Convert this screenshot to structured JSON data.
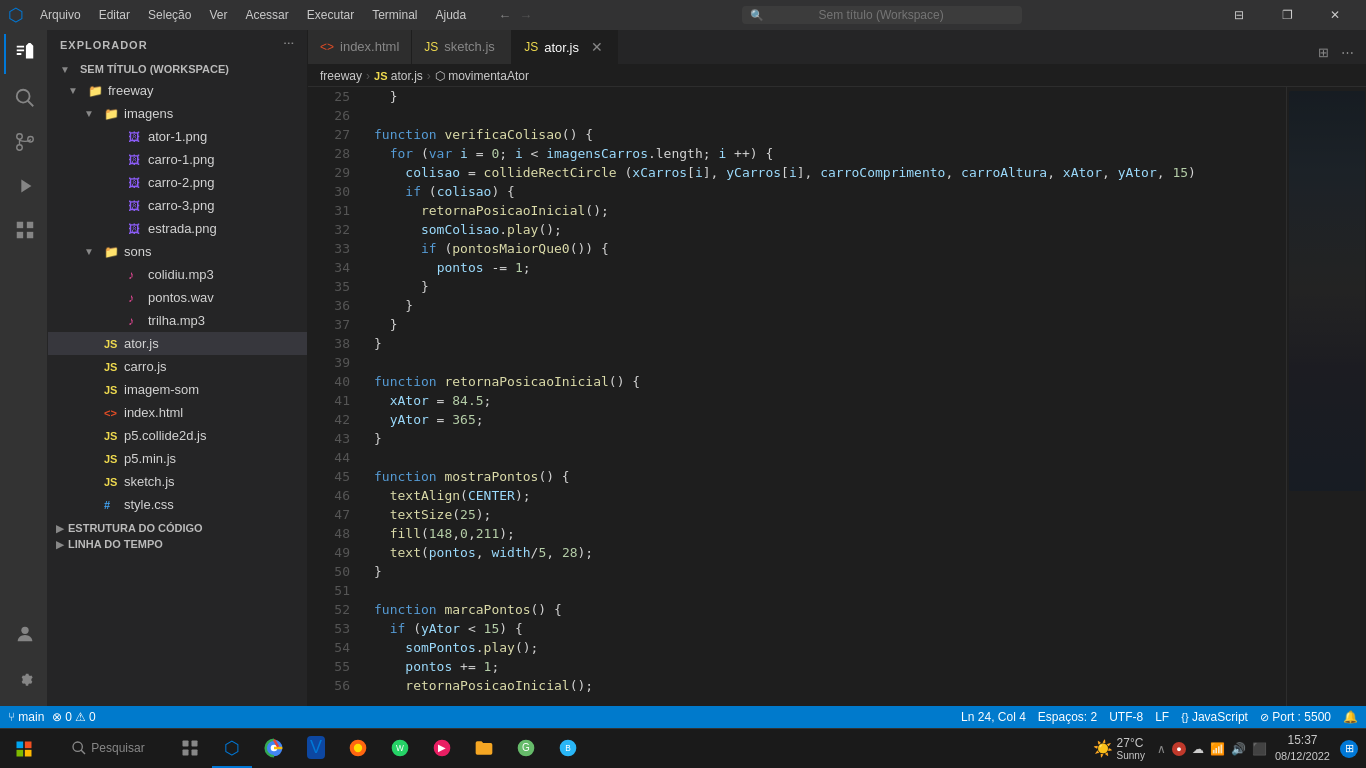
{
  "titlebar": {
    "icon": "⬡",
    "menu": [
      "Arquivo",
      "Editar",
      "Seleção",
      "Ver",
      "Acessar",
      "Executar",
      "Terminal",
      "Ajuda"
    ],
    "search_placeholder": "Sem título (Workspace)",
    "nav_back": "←",
    "nav_fwd": "→",
    "controls": [
      "⊟",
      "❐",
      "✕"
    ]
  },
  "tabs": [
    {
      "id": "index-html",
      "icon": "html",
      "label": "index.html",
      "active": false,
      "closable": false
    },
    {
      "id": "sketch-js",
      "icon": "js",
      "label": "sketch.js",
      "active": false,
      "closable": false
    },
    {
      "id": "ator-js",
      "icon": "js",
      "label": "ator.js",
      "active": true,
      "closable": true
    }
  ],
  "breadcrumb": [
    "freeway",
    "JS ator.js",
    "⬡ movimentaAtor"
  ],
  "explorer": {
    "title": "EXPLORADOR",
    "workspace_label": "SEM TÍTULO (WORKSPACE)",
    "tree": [
      {
        "type": "folder",
        "label": "freeway",
        "indent": 0,
        "open": true
      },
      {
        "type": "folder",
        "label": "imagens",
        "indent": 1,
        "open": true
      },
      {
        "type": "file",
        "label": "ator-1.png",
        "indent": 2,
        "filetype": "png"
      },
      {
        "type": "file",
        "label": "carro-1.png",
        "indent": 2,
        "filetype": "png"
      },
      {
        "type": "file",
        "label": "carro-2.png",
        "indent": 2,
        "filetype": "png"
      },
      {
        "type": "file",
        "label": "carro-3.png",
        "indent": 2,
        "filetype": "png"
      },
      {
        "type": "file",
        "label": "estrada.png",
        "indent": 2,
        "filetype": "png"
      },
      {
        "type": "folder",
        "label": "sons",
        "indent": 1,
        "open": true
      },
      {
        "type": "file",
        "label": "colidiu.mp3",
        "indent": 2,
        "filetype": "audio"
      },
      {
        "type": "file",
        "label": "pontos.wav",
        "indent": 2,
        "filetype": "audio"
      },
      {
        "type": "file",
        "label": "trilha.mp3",
        "indent": 2,
        "filetype": "audio"
      },
      {
        "type": "file",
        "label": "ator.js",
        "indent": 1,
        "filetype": "js",
        "selected": true
      },
      {
        "type": "file",
        "label": "carro.js",
        "indent": 1,
        "filetype": "js"
      },
      {
        "type": "file",
        "label": "imagem-som",
        "indent": 1,
        "filetype": "js"
      },
      {
        "type": "file",
        "label": "index.html",
        "indent": 1,
        "filetype": "html"
      },
      {
        "type": "file",
        "label": "p5.collide2d.js",
        "indent": 1,
        "filetype": "js"
      },
      {
        "type": "file",
        "label": "p5.min.js",
        "indent": 1,
        "filetype": "js"
      },
      {
        "type": "file",
        "label": "sketch.js",
        "indent": 1,
        "filetype": "js"
      },
      {
        "type": "file",
        "label": "style.css",
        "indent": 1,
        "filetype": "css"
      }
    ],
    "sections": [
      {
        "label": "ESTRUTURA DO CÓDIGO"
      },
      {
        "label": "LINHA DO TEMPO"
      }
    ]
  },
  "sidebar_icons": [
    {
      "id": "explorer",
      "symbol": "⧉",
      "active": true
    },
    {
      "id": "search",
      "symbol": "🔍",
      "active": false
    },
    {
      "id": "git",
      "symbol": "⑂",
      "active": false
    },
    {
      "id": "debug",
      "symbol": "▷",
      "active": false
    },
    {
      "id": "extensions",
      "symbol": "⊞",
      "active": false
    }
  ],
  "code_lines": [
    {
      "num": 25,
      "content": "  }"
    },
    {
      "num": 26,
      "content": ""
    },
    {
      "num": 27,
      "content": "function verificaColisao() {",
      "tokens": [
        {
          "t": "kw",
          "v": "function"
        },
        {
          "t": "punct",
          "v": " "
        },
        {
          "t": "fn",
          "v": "verificaColisao"
        },
        {
          "t": "punct",
          "v": "() {"
        }
      ]
    },
    {
      "num": 28,
      "content": "  for (var i = 0; i < imagensCarros.length; i ++) {",
      "tokens": [
        {
          "t": "kw",
          "v": "  for"
        },
        {
          "t": "punct",
          "v": " ("
        },
        {
          "t": "kw",
          "v": "var"
        },
        {
          "t": "punct",
          "v": " "
        },
        {
          "t": "var",
          "v": "i"
        },
        {
          "t": "punct",
          "v": " = "
        },
        {
          "t": "num",
          "v": "0"
        },
        {
          "t": "punct",
          "v": "; "
        },
        {
          "t": "var",
          "v": "i"
        },
        {
          "t": "punct",
          "v": " < "
        },
        {
          "t": "var",
          "v": "imagensCarros"
        },
        {
          "t": "punct",
          "v": ".length; "
        },
        {
          "t": "var",
          "v": "i"
        },
        {
          "t": "punct",
          "v": " ++) {"
        }
      ]
    },
    {
      "num": 29,
      "content": "    colisao = collideRectCircle (xCarros[i], yCarros[i], carroComprimento, carroAltura, xAtor, yAtor, 15)",
      "tokens": [
        {
          "t": "punct",
          "v": "    "
        },
        {
          "t": "var",
          "v": "colisao"
        },
        {
          "t": "punct",
          "v": " = "
        },
        {
          "t": "fn",
          "v": "collideRectCircle"
        },
        {
          "t": "punct",
          "v": " ("
        },
        {
          "t": "var",
          "v": "xCarros"
        },
        {
          "t": "punct",
          "v": "["
        },
        {
          "t": "var",
          "v": "i"
        },
        {
          "t": "punct",
          "v": "], "
        },
        {
          "t": "var",
          "v": "yCarros"
        },
        {
          "t": "punct",
          "v": "["
        },
        {
          "t": "var",
          "v": "i"
        },
        {
          "t": "punct",
          "v": "], "
        },
        {
          "t": "var",
          "v": "carroComprimento"
        },
        {
          "t": "punct",
          "v": ", "
        },
        {
          "t": "var",
          "v": "carroAltura"
        },
        {
          "t": "punct",
          "v": ", "
        },
        {
          "t": "var",
          "v": "xAtor"
        },
        {
          "t": "punct",
          "v": ", "
        },
        {
          "t": "var",
          "v": "yAtor"
        },
        {
          "t": "punct",
          "v": ", "
        },
        {
          "t": "num",
          "v": "15"
        },
        {
          "t": "punct",
          "v": ")"
        }
      ]
    },
    {
      "num": 30,
      "content": "    if (colisao) {",
      "tokens": [
        {
          "t": "kw",
          "v": "    if"
        },
        {
          "t": "punct",
          "v": " ("
        },
        {
          "t": "var",
          "v": "colisao"
        },
        {
          "t": "punct",
          "v": ") {"
        }
      ]
    },
    {
      "num": 31,
      "content": "      retornaPosicaoInicial();",
      "tokens": [
        {
          "t": "punct",
          "v": "      "
        },
        {
          "t": "fn",
          "v": "retornaPosicaoInicial"
        },
        {
          "t": "punct",
          "v": "();"
        }
      ]
    },
    {
      "num": 32,
      "content": "      somColisao.play();",
      "tokens": [
        {
          "t": "punct",
          "v": "      "
        },
        {
          "t": "var",
          "v": "somColisao"
        },
        {
          "t": "punct",
          "v": "."
        },
        {
          "t": "fn",
          "v": "play"
        },
        {
          "t": "punct",
          "v": "();"
        }
      ]
    },
    {
      "num": 33,
      "content": "      if (pontosMaiorQue0()) {",
      "tokens": [
        {
          "t": "kw",
          "v": "      if"
        },
        {
          "t": "punct",
          "v": " ("
        },
        {
          "t": "fn",
          "v": "pontosMaiorQue0"
        },
        {
          "t": "punct",
          "v": "()) {"
        }
      ]
    },
    {
      "num": 34,
      "content": "        pontos -= 1;",
      "tokens": [
        {
          "t": "punct",
          "v": "        "
        },
        {
          "t": "var",
          "v": "pontos"
        },
        {
          "t": "punct",
          "v": " -= "
        },
        {
          "t": "num",
          "v": "1"
        },
        {
          "t": "punct",
          "v": ";"
        }
      ]
    },
    {
      "num": 35,
      "content": "      }"
    },
    {
      "num": 36,
      "content": "    }"
    },
    {
      "num": 37,
      "content": "  }"
    },
    {
      "num": 38,
      "content": "}"
    },
    {
      "num": 39,
      "content": ""
    },
    {
      "num": 40,
      "content": "function retornaPosicaoInicial() {",
      "tokens": [
        {
          "t": "kw",
          "v": "function"
        },
        {
          "t": "punct",
          "v": " "
        },
        {
          "t": "fn",
          "v": "retornaPosicaoInicial"
        },
        {
          "t": "punct",
          "v": "() {"
        }
      ]
    },
    {
      "num": 41,
      "content": "  xAtor = 84.5;",
      "tokens": [
        {
          "t": "punct",
          "v": "  "
        },
        {
          "t": "var",
          "v": "xAtor"
        },
        {
          "t": "punct",
          "v": " = "
        },
        {
          "t": "num",
          "v": "84.5"
        },
        {
          "t": "punct",
          "v": ";"
        }
      ]
    },
    {
      "num": 42,
      "content": "  yAtor = 365;",
      "tokens": [
        {
          "t": "punct",
          "v": "  "
        },
        {
          "t": "var",
          "v": "yAtor"
        },
        {
          "t": "punct",
          "v": " = "
        },
        {
          "t": "num",
          "v": "365"
        },
        {
          "t": "punct",
          "v": ";"
        }
      ]
    },
    {
      "num": 43,
      "content": "}"
    },
    {
      "num": 44,
      "content": ""
    },
    {
      "num": 45,
      "content": "function mostraPontos() {",
      "tokens": [
        {
          "t": "kw",
          "v": "function"
        },
        {
          "t": "punct",
          "v": " "
        },
        {
          "t": "fn",
          "v": "mostraPontos"
        },
        {
          "t": "punct",
          "v": "() {"
        }
      ]
    },
    {
      "num": 46,
      "content": "  textAlign(CENTER);",
      "tokens": [
        {
          "t": "punct",
          "v": "  "
        },
        {
          "t": "fn",
          "v": "textAlign"
        },
        {
          "t": "punct",
          "v": "("
        },
        {
          "t": "var",
          "v": "CENTER"
        },
        {
          "t": "punct",
          "v": ");"
        }
      ]
    },
    {
      "num": 47,
      "content": "  textSize(25);",
      "tokens": [
        {
          "t": "punct",
          "v": "  "
        },
        {
          "t": "fn",
          "v": "textSize"
        },
        {
          "t": "punct",
          "v": "("
        },
        {
          "t": "num",
          "v": "25"
        },
        {
          "t": "punct",
          "v": ");"
        }
      ]
    },
    {
      "num": 48,
      "content": "  fill(148,0,211);",
      "tokens": [
        {
          "t": "punct",
          "v": "  "
        },
        {
          "t": "fn",
          "v": "fill"
        },
        {
          "t": "punct",
          "v": "("
        },
        {
          "t": "num",
          "v": "148"
        },
        {
          "t": "punct",
          "v": ","
        },
        {
          "t": "num",
          "v": "0"
        },
        {
          "t": "punct",
          "v": ","
        },
        {
          "t": "num",
          "v": "211"
        },
        {
          "t": "punct",
          "v": ");"
        }
      ]
    },
    {
      "num": 49,
      "content": "  text(pontos, width/5, 28);",
      "tokens": [
        {
          "t": "punct",
          "v": "  "
        },
        {
          "t": "fn",
          "v": "text"
        },
        {
          "t": "punct",
          "v": "("
        },
        {
          "t": "var",
          "v": "pontos"
        },
        {
          "t": "punct",
          "v": ", "
        },
        {
          "t": "var",
          "v": "width"
        },
        {
          "t": "punct",
          "v": "/"
        },
        {
          "t": "num",
          "v": "5"
        },
        {
          "t": "punct",
          "v": ", "
        },
        {
          "t": "num",
          "v": "28"
        },
        {
          "t": "punct",
          "v": ");"
        }
      ]
    },
    {
      "num": 50,
      "content": "}"
    },
    {
      "num": 51,
      "content": ""
    },
    {
      "num": 52,
      "content": "function marcaPontos() {",
      "tokens": [
        {
          "t": "kw",
          "v": "function"
        },
        {
          "t": "punct",
          "v": " "
        },
        {
          "t": "fn",
          "v": "marcaPontos"
        },
        {
          "t": "punct",
          "v": "() {"
        }
      ]
    },
    {
      "num": 53,
      "content": "  if (yAtor < 15) {",
      "tokens": [
        {
          "t": "kw",
          "v": "  if"
        },
        {
          "t": "punct",
          "v": " ("
        },
        {
          "t": "var",
          "v": "yAtor"
        },
        {
          "t": "punct",
          "v": " < "
        },
        {
          "t": "num",
          "v": "15"
        },
        {
          "t": "punct",
          "v": ") {"
        }
      ]
    },
    {
      "num": 54,
      "content": "    somPontos.play();",
      "tokens": [
        {
          "t": "punct",
          "v": "    "
        },
        {
          "t": "var",
          "v": "somPontos"
        },
        {
          "t": "punct",
          "v": "."
        },
        {
          "t": "fn",
          "v": "play"
        },
        {
          "t": "punct",
          "v": "();"
        }
      ]
    },
    {
      "num": 55,
      "content": "    pontos += 1;",
      "tokens": [
        {
          "t": "punct",
          "v": "    "
        },
        {
          "t": "var",
          "v": "pontos"
        },
        {
          "t": "punct",
          "v": " += "
        },
        {
          "t": "num",
          "v": "1"
        },
        {
          "t": "punct",
          "v": ";"
        }
      ]
    },
    {
      "num": 56,
      "content": "    retornaPosicaoInicial();",
      "tokens": [
        {
          "t": "punct",
          "v": "    "
        },
        {
          "t": "fn",
          "v": "retornaPosicaoInicial"
        },
        {
          "t": "punct",
          "v": "();"
        }
      ]
    }
  ],
  "statusbar": {
    "errors": "0",
    "warnings": "0",
    "line": "Ln 24",
    "col": "Col 4",
    "spaces": "Espaços: 2",
    "encoding": "UTF-8",
    "line_ending": "LF",
    "language": "JavaScript",
    "port": "Port : 5500"
  },
  "taskbar": {
    "weather": "27°C",
    "weather_desc": "Sunny",
    "time": "15:37",
    "date": "08/12/2022"
  }
}
